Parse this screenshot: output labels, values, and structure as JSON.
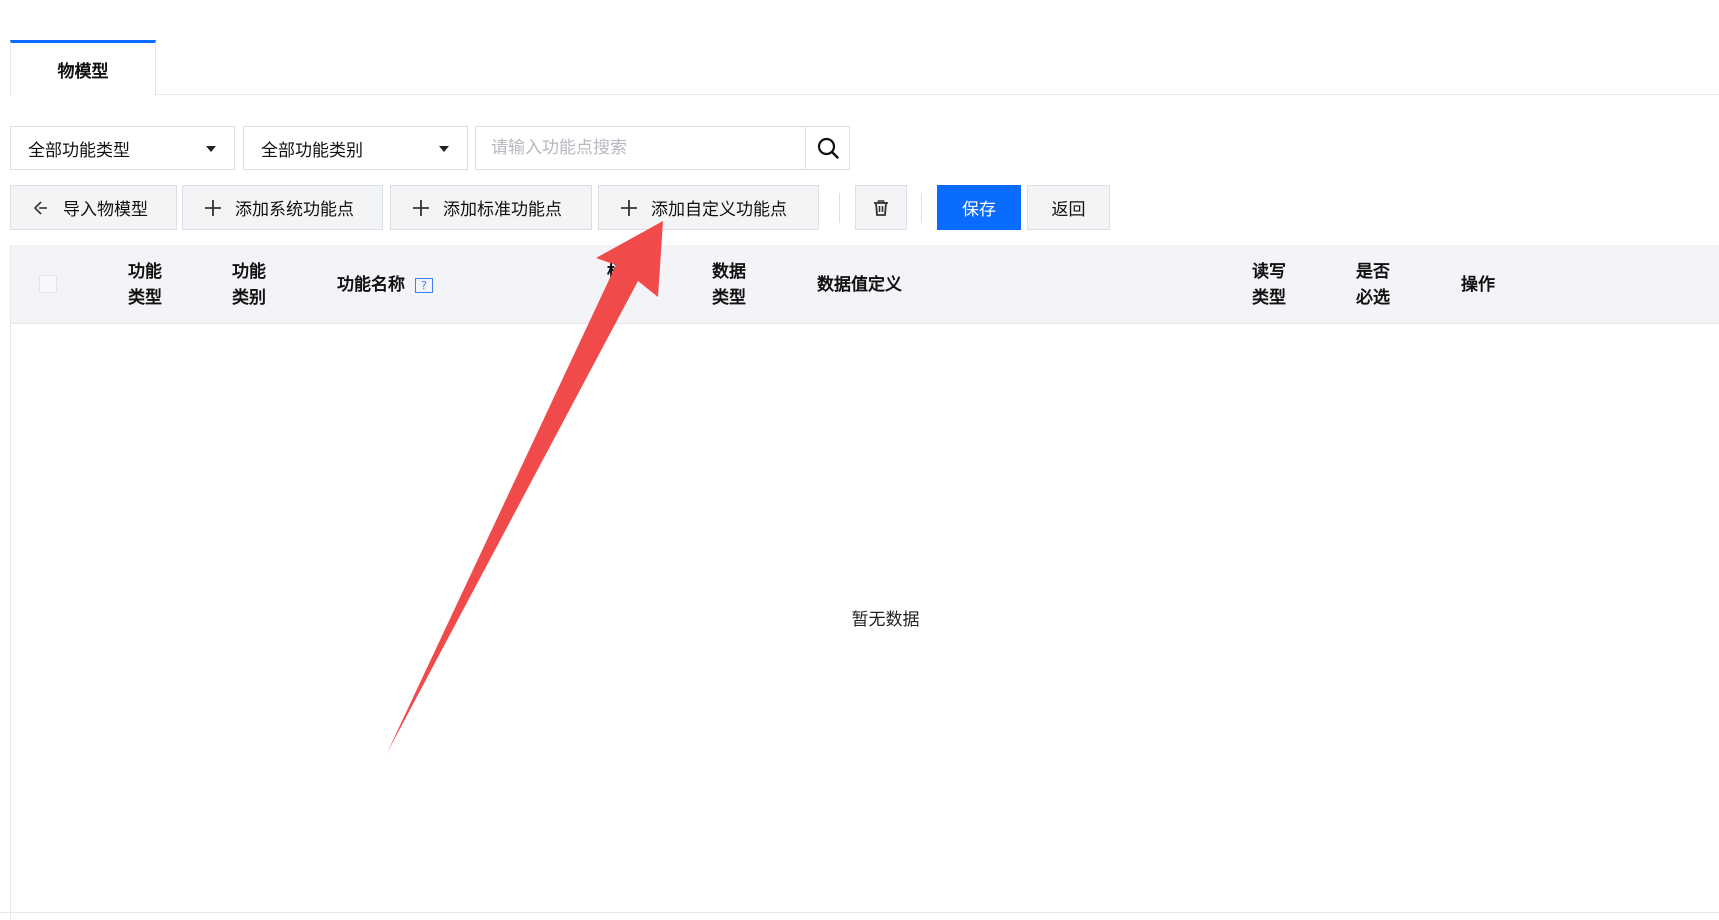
{
  "tabs": [
    {
      "label": "物模型",
      "active": true
    }
  ],
  "filters": {
    "type_select": "全部功能类型",
    "category_select": "全部功能类别",
    "search_placeholder": "请输入功能点搜索"
  },
  "toolbar": {
    "import_label": "导入物模型",
    "add_system_label": "添加系统功能点",
    "add_standard_label": "添加标准功能点",
    "add_custom_label": "添加自定义功能点",
    "save_label": "保存",
    "back_label": "返回"
  },
  "table": {
    "columns": {
      "func_type": "功能类型",
      "func_category": "功能类别",
      "func_name": "功能名称",
      "identifier": "标识符",
      "data_type": "数据类型",
      "data_def": "数据值定义",
      "rw_type": "读写类型",
      "required": "是否必选",
      "action": "操作"
    },
    "empty_text": "暂无数据"
  },
  "colors": {
    "primary": "#0a6cff",
    "annotation_arrow": "#f04a4a"
  }
}
